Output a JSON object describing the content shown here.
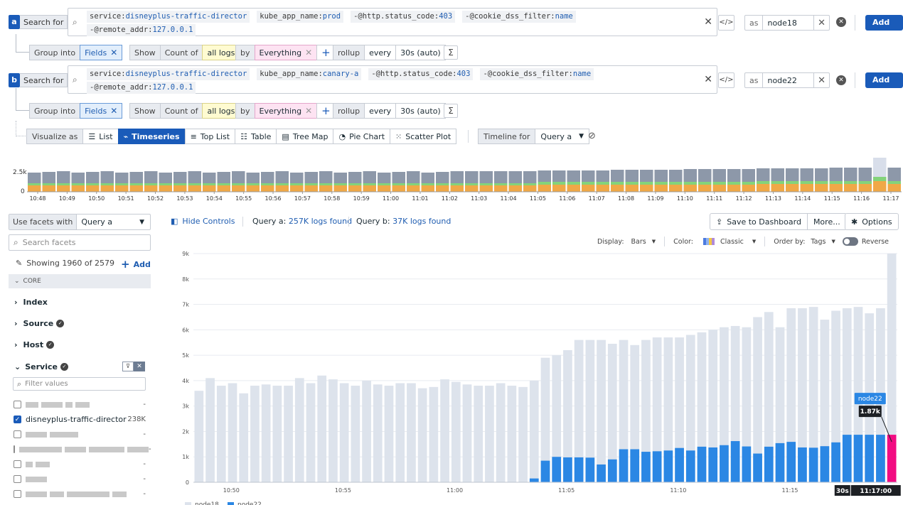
{
  "query_a": {
    "badge": "a",
    "search_for": "Search for",
    "tokens": [
      {
        "k": "service:",
        "v": "disneyplus-traffic-director"
      },
      {
        "k": "kube_app_name:",
        "v": "prod"
      },
      {
        "k": "-@http.status_code:",
        "v": "403"
      },
      {
        "k": "-@cookie_dss_filter:",
        "v": "name"
      }
    ],
    "tokens_line2": [
      {
        "k": "-@remote_addr:",
        "v": "127.0.0.1"
      }
    ],
    "as_label": "as",
    "alias": "node18",
    "add_label": "Add ▾",
    "group_into": "Group into",
    "fields": "Fields",
    "show": "Show",
    "count_of": "Count of",
    "all_logs": "all logs",
    "by": "by",
    "everything": "Everything",
    "rollup": "rollup",
    "every": "every",
    "interval": "30s (auto)"
  },
  "query_b": {
    "badge": "b",
    "search_for": "Search for",
    "tokens": [
      {
        "k": "service:",
        "v": "disneyplus-traffic-director"
      },
      {
        "k": "kube_app_name:",
        "v": "canary-a"
      },
      {
        "k": "-@http.status_code:",
        "v": "403"
      },
      {
        "k": "-@cookie_dss_filter:",
        "v": "name"
      }
    ],
    "tokens_line2": [
      {
        "k": "-@remote_addr:",
        "v": "127.0.0.1"
      }
    ],
    "as_label": "as",
    "alias": "node22",
    "add_label": "Add ▾",
    "group_into": "Group into",
    "fields": "Fields",
    "show": "Show",
    "count_of": "Count of",
    "all_logs": "all logs",
    "by": "by",
    "everything": "Everything",
    "rollup": "rollup",
    "every": "every",
    "interval": "30s (auto)"
  },
  "visualize": {
    "label": "Visualize as",
    "tabs": [
      "List",
      "Timeseries",
      "Top List",
      "Table",
      "Tree Map",
      "Pie Chart",
      "Scatter Plot"
    ],
    "active": "Timeseries",
    "timeline_for": "Timeline for",
    "timeline_query": "Query a"
  },
  "timeline": {
    "y_label": "2.5k",
    "y_zero": "0",
    "ticks": [
      "10:48",
      "10:49",
      "10:50",
      "10:51",
      "10:52",
      "10:53",
      "10:54",
      "10:55",
      "10:56",
      "10:57",
      "10:58",
      "10:59",
      "11:00",
      "11:01",
      "11:02",
      "11:03",
      "11:04",
      "11:05",
      "11:06",
      "11:07",
      "11:08",
      "11:09",
      "11:10",
      "11:11",
      "11:12",
      "11:13",
      "11:14",
      "11:15",
      "11:16",
      "11:17"
    ],
    "colors": {
      "grey": "#8d98a9",
      "green": "#84d37a",
      "orange": "#f0a847"
    }
  },
  "facets": {
    "use_facets_with": "Use facets with",
    "query": "Query a",
    "search_placeholder": "Search facets",
    "showing": "Showing 1960 of 2579",
    "add": "Add",
    "core": "CORE",
    "groups": [
      "Index",
      "Source",
      "Host",
      "Service"
    ],
    "filter_placeholder": "Filter values",
    "service_values": [
      {
        "label": "",
        "count": "-",
        "checked": false,
        "blur": [
          18,
          30,
          10,
          20
        ]
      },
      {
        "label": "disneyplus-traffic-director",
        "count": "238K",
        "checked": true
      },
      {
        "label": "",
        "count": "-",
        "checked": false,
        "blur": [
          30,
          40
        ]
      },
      {
        "label": "",
        "count": "-",
        "checked": false,
        "blur": [
          60,
          30,
          50,
          30
        ]
      },
      {
        "label": "",
        "count": "-",
        "checked": false,
        "blur": [
          10,
          20
        ]
      },
      {
        "label": "",
        "count": "-",
        "checked": false,
        "blur": [
          30
        ]
      },
      {
        "label": "",
        "count": "-",
        "checked": false,
        "blur": [
          30,
          20,
          60,
          20
        ]
      }
    ]
  },
  "controls": {
    "hide_controls": "Hide Controls",
    "query_a_label": "Query a:",
    "query_a_count": "257K logs found",
    "query_b_label": "Query b:",
    "query_b_count": "37K logs found",
    "save_to_dashboard": "Save to Dashboard",
    "more": "More...",
    "options": "Options",
    "display_label": "Display:",
    "display_value": "Bars",
    "color_label": "Color:",
    "color_value": "Classic",
    "order_label": "Order by:",
    "order_value": "Tags",
    "reverse": "Reverse"
  },
  "chart_data": {
    "type": "bar",
    "y_ticks": [
      "0",
      "1k",
      "2k",
      "3k",
      "4k",
      "5k",
      "6k",
      "7k",
      "8k",
      "9k"
    ],
    "x_ticks": [
      "10:50",
      "10:55",
      "11:00",
      "11:05",
      "11:10",
      "11:15"
    ],
    "ylim": [
      0,
      9000
    ],
    "series": [
      {
        "name": "node18",
        "color": "#dde3ec",
        "values": [
          3600,
          4100,
          3800,
          3900,
          3500,
          3800,
          3850,
          3800,
          3800,
          4100,
          3900,
          4200,
          4050,
          3900,
          3800,
          4000,
          3850,
          3800,
          3900,
          3900,
          3700,
          3750,
          4050,
          3950,
          3850,
          3800,
          3800,
          3900,
          3800,
          3750,
          4000,
          4900,
          5000,
          5200,
          5600,
          5600,
          5600,
          5450,
          5600,
          5400,
          5600,
          5700,
          5700,
          5700,
          5800,
          5900,
          6000,
          6100,
          6150,
          6100,
          6500,
          6700,
          6100,
          6850,
          6850,
          6900,
          6400,
          6750,
          6850,
          6900,
          6650,
          6850,
          9000
        ]
      },
      {
        "name": "node22",
        "color": "#2b87e4",
        "values": [
          0,
          0,
          0,
          0,
          0,
          0,
          0,
          0,
          0,
          0,
          0,
          0,
          0,
          0,
          0,
          0,
          0,
          0,
          0,
          0,
          0,
          0,
          0,
          0,
          0,
          0,
          0,
          0,
          0,
          0,
          150,
          850,
          1000,
          980,
          980,
          970,
          700,
          900,
          1300,
          1300,
          1200,
          1220,
          1250,
          1350,
          1250,
          1400,
          1370,
          1460,
          1620,
          1410,
          1130,
          1400,
          1540,
          1590,
          1370,
          1360,
          1420,
          1570,
          1870,
          1870,
          1870,
          1870,
          0
        ]
      }
    ],
    "highlight": {
      "series": "node22",
      "value": "1.87k",
      "label_series": "node22",
      "time": "11:17:00",
      "interval": "30s"
    },
    "highlight_color": "#f20c82"
  }
}
